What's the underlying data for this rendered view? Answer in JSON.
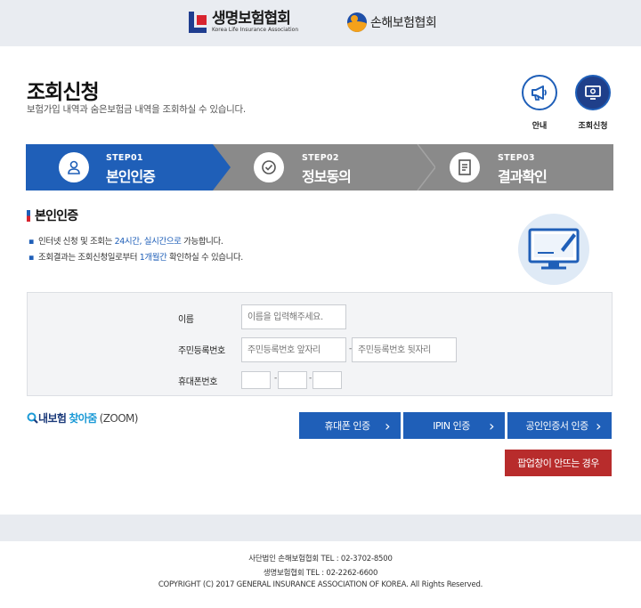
{
  "header": {
    "logo_life_ko": "생명보험협회",
    "logo_life_en": "Korea Life Insurance Association",
    "logo_general_ko": "손해보험협회"
  },
  "page": {
    "title": "조회신청",
    "subtitle": "보험가입 내역과 숨은보험금 내역을 조회하실 수 있습니다."
  },
  "quick": {
    "guide_label": "안내",
    "apply_label": "조회신청"
  },
  "steps": [
    {
      "no": "STEP01",
      "name": "본인인증",
      "icon": "person-icon",
      "active": true
    },
    {
      "no": "STEP02",
      "name": "정보동의",
      "icon": "check-icon",
      "active": false
    },
    {
      "no": "STEP03",
      "name": "결과확인",
      "icon": "document-icon",
      "active": false
    }
  ],
  "section": {
    "title": "본인인증",
    "bullet1_a": "인터넷 신청 및 조회는 ",
    "bullet1_hl": "24시간, 실시간으로",
    "bullet1_b": " 가능합니다.",
    "bullet2_a": "조회결과는 조회신청일로부터 ",
    "bullet2_hl": "1개월간",
    "bullet2_b": " 확인하실 수 있습니다."
  },
  "form": {
    "name_label": "이름",
    "name_placeholder": "이름을 입력해주세요.",
    "rrn_label": "주민등록번호",
    "rrn_front_placeholder": "주민등록번호 앞자리",
    "rrn_back_placeholder": "주민등록번호 뒷자리",
    "phone_label": "휴대폰번호",
    "dash": "-"
  },
  "zoom": {
    "a": "내보험",
    "b": "찾아줌",
    "c": "(ZOOM)"
  },
  "buttons": {
    "phone_auth": "휴대폰 인증",
    "ipin_auth": "IPIN 인증",
    "cert_auth": "공인인증서 인증",
    "popup_help": "팝업창이 안뜨는 경우",
    "arrow": "›"
  },
  "footer": {
    "line1": "사단법인 손해보험협회 TEL : 02-3702-8500",
    "line2": "생명보험협회 TEL : 02-2262-6600",
    "line3": "COPYRIGHT (C) 2017 GENERAL INSURANCE ASSOCIATION OF KOREA. All Rights Reserved."
  },
  "colors": {
    "primary": "#1f5fb8",
    "step_inactive": "#8a8a8a",
    "popup_red": "#b82c2c"
  }
}
